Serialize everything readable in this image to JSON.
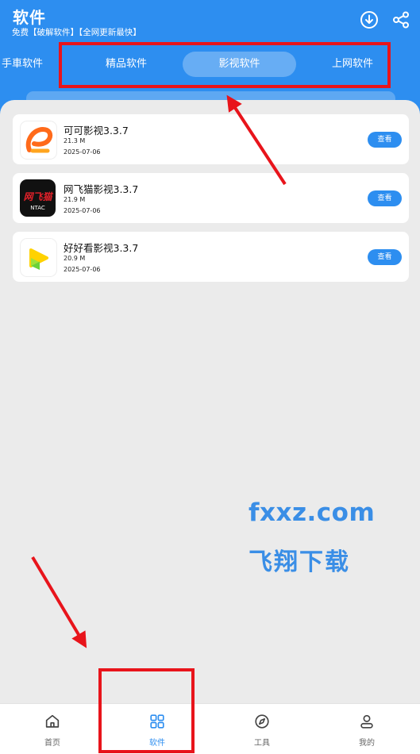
{
  "header": {
    "title": "软件",
    "subtitle": "免费【破解软件】【全网更新最快】",
    "download_icon": "download-circle-icon",
    "share_icon": "share-icon"
  },
  "tabs": [
    {
      "label": "手車软件",
      "active": false
    },
    {
      "label": "精品软件",
      "active": false
    },
    {
      "label": "影视软件",
      "active": true
    },
    {
      "label": "上网软件",
      "active": false
    }
  ],
  "apps": [
    {
      "name": "可可影视3.3.7",
      "size": "21.3 M",
      "date": "2025-07-06",
      "action": "查看",
      "icon": "keke-app-icon"
    },
    {
      "name": "网飞猫影视3.3.7",
      "size": "21.9 M",
      "date": "2025-07-06",
      "action": "查看",
      "icon": "netflix-cat-app-icon",
      "icon_text": "网飞猫",
      "icon_subtext": "NTAC"
    },
    {
      "name": "好好看影视3.3.7",
      "size": "20.9 M",
      "date": "2025-07-06",
      "action": "查看",
      "icon": "haohaokan-app-icon"
    }
  ],
  "watermark": {
    "line1": "fxxz.com",
    "line2": "飞翔下载"
  },
  "nav": [
    {
      "label": "首页",
      "icon": "home-icon",
      "active": false
    },
    {
      "label": "软件",
      "icon": "grid-icon",
      "active": true
    },
    {
      "label": "工具",
      "icon": "compass-icon",
      "active": false
    },
    {
      "label": "我的",
      "icon": "user-icon",
      "active": false
    }
  ],
  "colors": {
    "accent": "#2d8ef0",
    "background": "#ebebeb",
    "annotation": "#e8141b",
    "watermark": "#3a8ee6"
  }
}
